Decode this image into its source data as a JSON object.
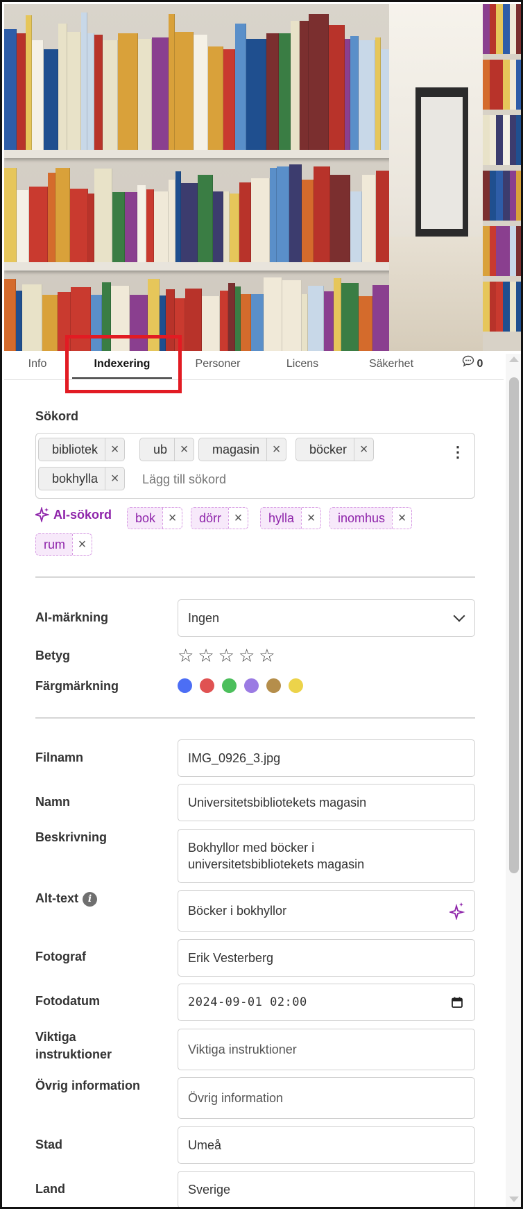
{
  "tabs": [
    {
      "label": "Info"
    },
    {
      "label": "Indexering",
      "active": true
    },
    {
      "label": "Personer"
    },
    {
      "label": "Licens"
    },
    {
      "label": "Säkerhet"
    },
    {
      "label": "0",
      "icon": "comment-icon"
    }
  ],
  "keywords": {
    "label": "Sökord",
    "items": [
      "bibliotek",
      "ub",
      "magasin",
      "böcker",
      "bokhylla"
    ],
    "add_placeholder": "Lägg till sökord",
    "menu_icon": "kebab-menu-icon"
  },
  "ai_keywords": {
    "label": "AI-sökord",
    "icon": "sparkle-icon",
    "items": [
      "bok",
      "dörr",
      "hylla",
      "inomhus",
      "rum"
    ]
  },
  "ai_marking": {
    "label": "AI-märkning",
    "value": "Ingen"
  },
  "rating": {
    "label": "Betyg",
    "value": 0,
    "max": 5
  },
  "color_marking": {
    "label": "Färgmärkning",
    "colors": [
      "#4c6ef5",
      "#e05252",
      "#4cbf5c",
      "#9b7be3",
      "#b58e4b",
      "#ecd34a"
    ]
  },
  "fields": {
    "filename": {
      "label": "Filnamn",
      "value": "IMG_0926_3.jpg"
    },
    "name": {
      "label": "Namn",
      "value": "Universitetsbibliotekets magasin"
    },
    "description": {
      "label": "Beskrivning",
      "line1": "Bokhyllor med böcker i",
      "line2": "universitetsbibliotekets magasin"
    },
    "alt_text": {
      "label": "Alt-text",
      "value": "Böcker i bokhyllor",
      "info_icon": "i"
    },
    "photographer": {
      "label": "Fotograf",
      "value": "Erik Vesterberg"
    },
    "photo_date": {
      "label": "Fotodatum",
      "value": "2024-09-01 02:00"
    },
    "important": {
      "label_line1": "Viktiga",
      "label_line2": "instruktioner",
      "placeholder": "Viktiga instruktioner"
    },
    "other_info": {
      "label": "Övrig information",
      "placeholder": "Övrig information"
    },
    "city": {
      "label": "Stad",
      "value": "Umeå"
    },
    "country": {
      "label": "Land",
      "value": "Sverige"
    }
  }
}
